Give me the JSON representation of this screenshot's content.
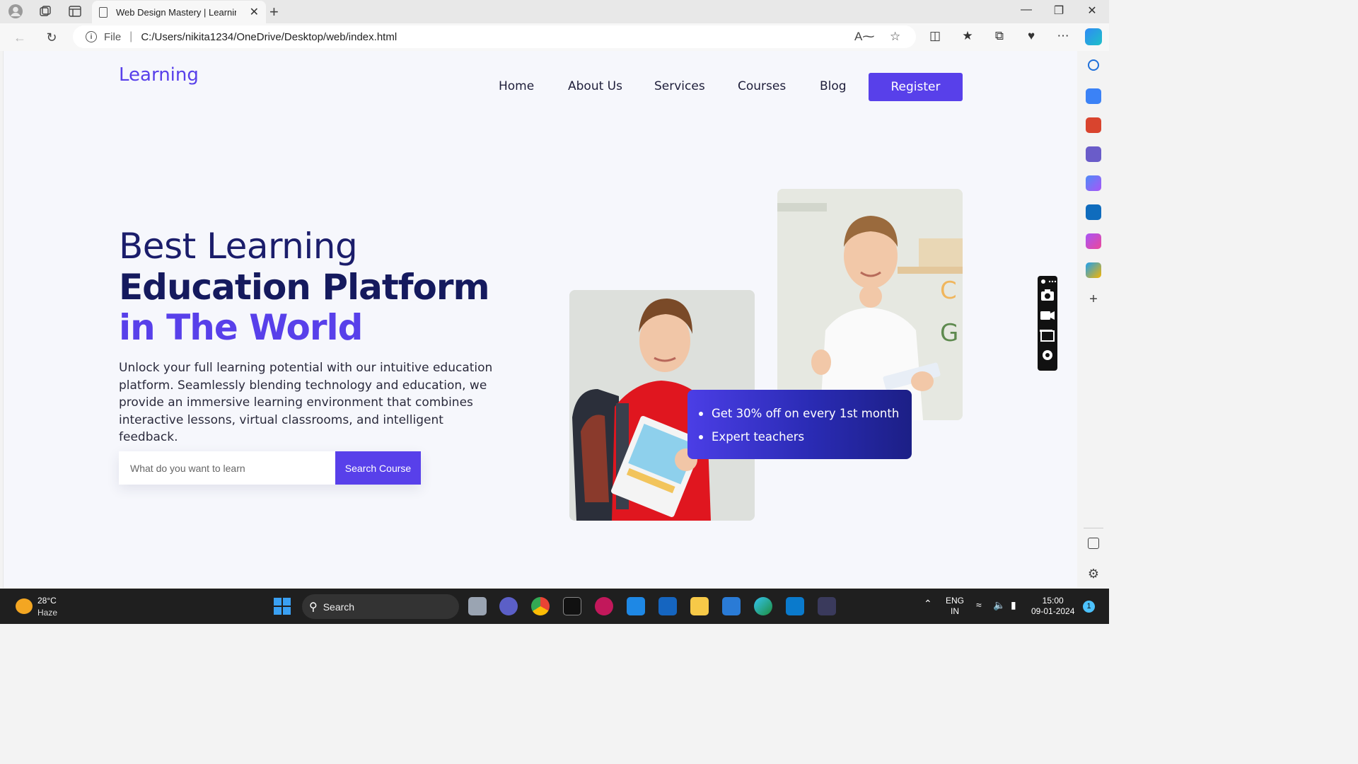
{
  "browser": {
    "tab_title": "Web Design Mastery | Learning L",
    "tab_close": "✕",
    "new_tab": "+",
    "url_scheme": "File",
    "url": "C:/Users/nikita1234/OneDrive/Desktop/web/index.html"
  },
  "site": {
    "logo": "Learning",
    "nav": [
      "Home",
      "About Us",
      "Services",
      "Courses",
      "Blog"
    ],
    "register": "Register",
    "hero": {
      "line1": "Best Learning",
      "line2": "Education Platform",
      "line3": "in The World",
      "description": "Unlock your full learning potential with our intuitive education platform. Seamlessly blending technology and education, we provide an immersive learning environment that combines interactive lessons, virtual classrooms, and intelligent feedback."
    },
    "search": {
      "placeholder": "What do you want to learn",
      "button": "Search Course"
    },
    "card": {
      "items": [
        "Get 30% off on every 1st month",
        "Expert teachers"
      ]
    }
  },
  "taskbar": {
    "weather_temp": "28°C",
    "weather_desc": "Haze",
    "search_label": "Search",
    "lang_line1": "ENG",
    "lang_line2": "IN",
    "time": "15:00",
    "date": "09-01-2024",
    "notification_count": "1"
  },
  "colors": {
    "brand": "#5840ea",
    "heading_dark": "#151a5e",
    "card_gradient_end": "#1c1f86"
  }
}
